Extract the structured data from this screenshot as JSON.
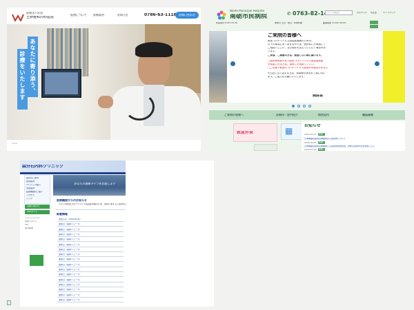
{
  "panel1": {
    "brand_small": "医療法人社団",
    "brand_name": "土野雅和内科医院",
    "nav": [
      "医院について",
      "診療案内",
      "お知らせ"
    ],
    "phone": "0786-63-1118",
    "cta": "お問い合わせ",
    "vertical_1": "あなたに寄り添う、",
    "vertical_2": "診療をいたします",
    "scroll": "scroll"
  },
  "panel2": {
    "subtitle": "Nanto Municipal Hospital",
    "title": "南砺市民病院",
    "phone": "0763-82-1475",
    "search_placeholder": "サイト内検索",
    "small_links": [
      "文字サイズ",
      "色変更",
      "サイトマップ"
    ],
    "hours": [
      "外来受付 8:30〜11:30",
      "休診日 土日・祝日・年末年始",
      "面会時間 13:00〜20:00"
    ],
    "notice_title": "ご来院の皆様へ",
    "notice_lines": [
      "新型コロナウイルス感染症関連のための、",
      "以下の事項にあてはまるかたは、受診前にお電話にて",
      "ご相談ください。当日受診を控えていただく場合があ",
      "ります。",
      "ご家族、ご親戚の方は、面会しない様に願います。"
    ],
    "notice_red": [
      "□発熱等体調不良で新型コロナウイルス感染症検査",
      "を希望される方は、事前にお電話ください。",
      "□ご自身や家族がコロナウイルス感染の可能性がある方"
    ],
    "notice_tail": [
      "※上記に当てはまる方は、体調等の状況を丁寧に伺い",
      "ます。ご協力をお願いいたします。",
      "病院長"
    ],
    "menu": [
      "ご来院の皆様へ",
      "診療科・部門紹介",
      "病院案内",
      "職員募集"
    ],
    "card_text": "救急外来",
    "news_heading": "お知らせ",
    "news_items": [
      {
        "date": "2020.05.12",
        "text": "新着",
        "body": "日本看護協会特定看護師の公認研修について"
      },
      {
        "date": "2020.05.08",
        "text": "新着",
        "body": "日本看護協会特定看護師と公認研修研修担当、研修の研修状況を報告したら"
      },
      {
        "date": "2020.04.28",
        "text": "新着",
        "body": ""
      }
    ]
  },
  "panel3": {
    "clinic_name": "森分石内科クリニック",
    "hero_text": "あなたの健康ライフを応援します",
    "side_items": [
      "医院のご案内",
      "診療案内",
      "クリニック紹介",
      "交通案内",
      "医療機器のご紹介",
      "アクセス",
      "リンク"
    ],
    "side_buttons": [
      "お問い合わせ",
      "Webサイト"
    ],
    "info_heading": "医療機関からのお知らせ",
    "info_text": "ただいま新型コロナウイルス感染症対策のため、受診に関するご案内をしております。",
    "news_heading": "新着情報",
    "news_lines": [
      "お知らせ（2020年5月）",
      "更新日（最新ニュース）",
      "更新日（最新ニュース）",
      "更新日（最新ニュース）",
      "更新日（最新ニュース）",
      "更新日（最新ニュース）",
      "更新日（最新ニュース）",
      "更新日（最新ニュース）",
      "更新日（最新ニュース）",
      "更新日（最新ニュース）",
      "更新日（最新ニュース）",
      "更新日（最新ニュース）",
      "更新日（最新ニュース）",
      "更新日（最新ニュース）",
      "更新日（最新ニュース）",
      "更新日（最新ニュース）",
      "更新日（最新ニュース）"
    ],
    "address": [
      "〒○○○-○○○○",
      "住所テキスト",
      "TEL",
      "受付時間"
    ]
  }
}
